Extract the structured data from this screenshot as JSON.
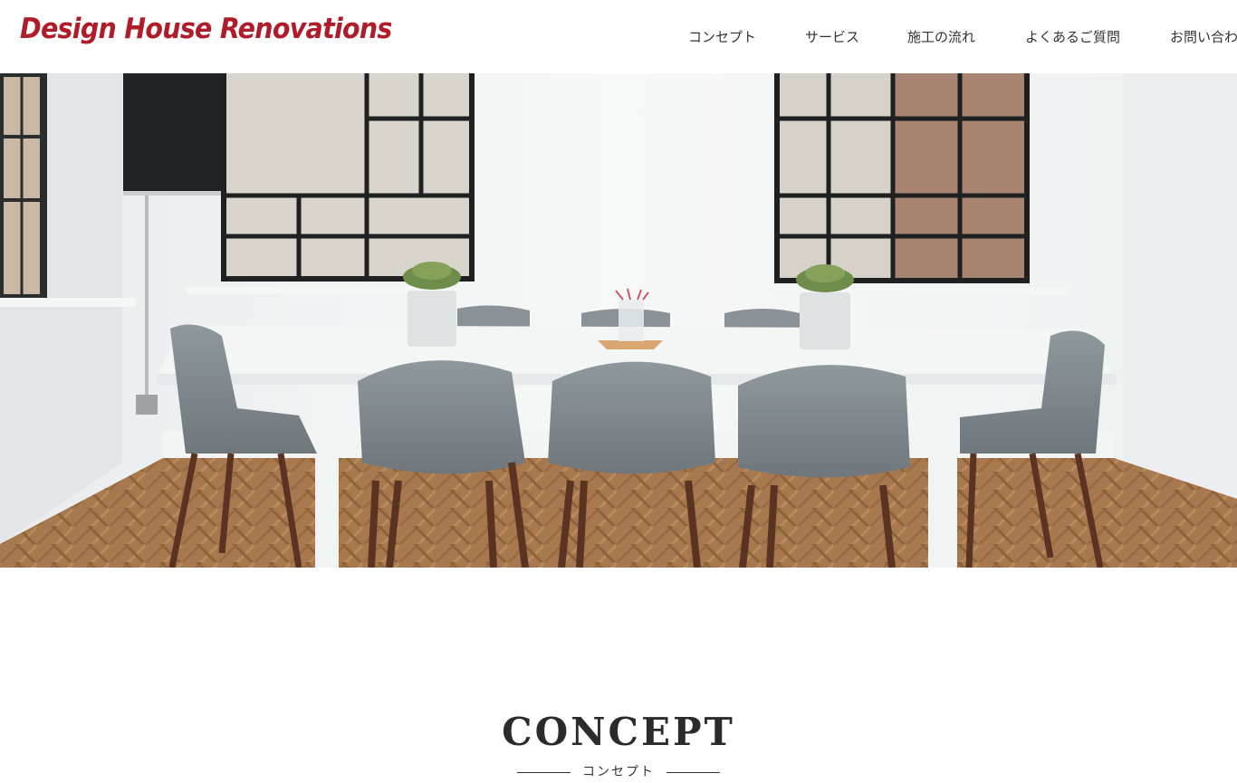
{
  "brand": {
    "logo_text": "Design House Renovations",
    "accent_color": "#b01d2a"
  },
  "nav": {
    "items": [
      {
        "label": "コンセプト"
      },
      {
        "label": "サービス"
      },
      {
        "label": "施工の流れ"
      },
      {
        "label": "よくあるご質問"
      },
      {
        "label": "お問い合わせ"
      }
    ]
  },
  "hero": {
    "image": "hero-photo"
  },
  "concept": {
    "title": "CONCEPT",
    "subtitle": "コンセプト"
  }
}
